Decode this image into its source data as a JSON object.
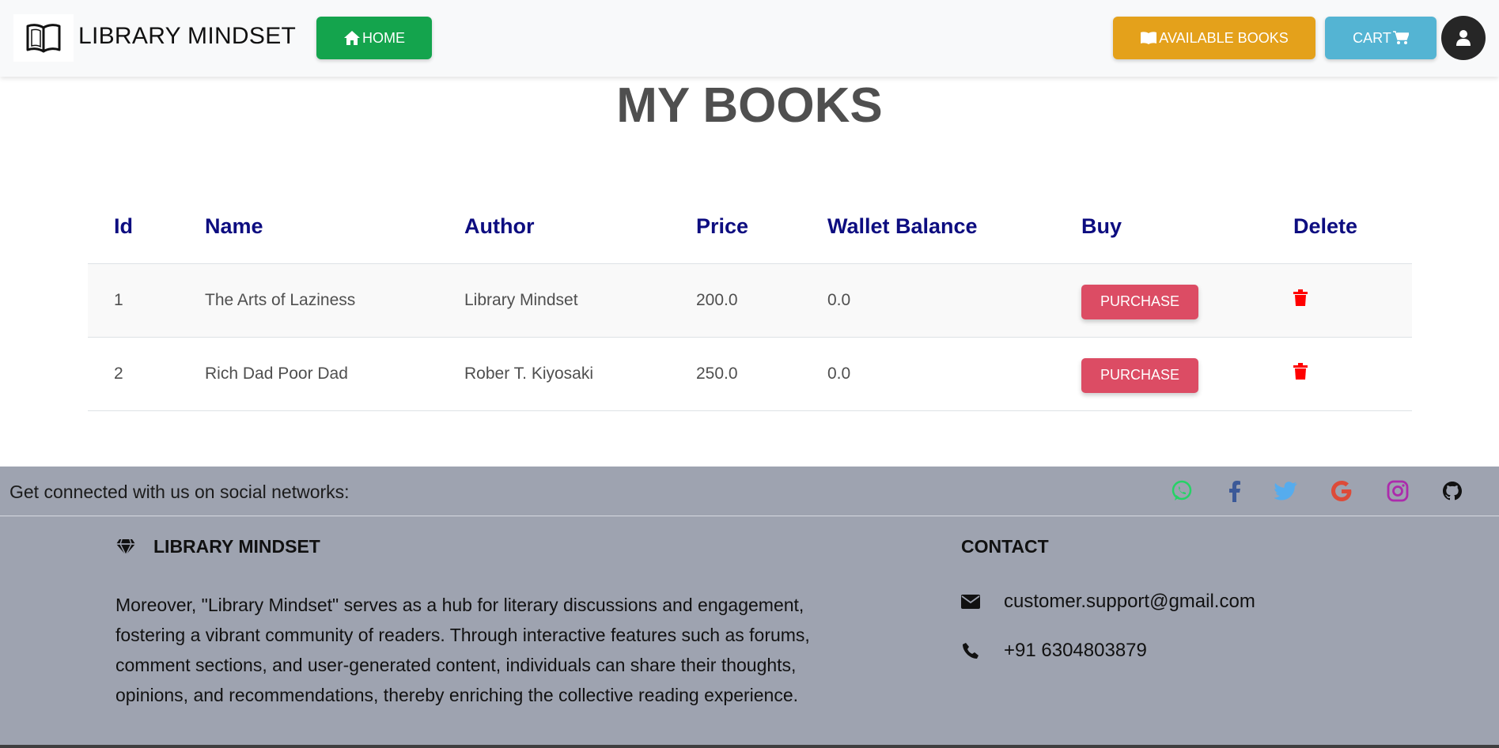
{
  "navbar": {
    "brand": "LIBRARY MINDSET",
    "home_label": "HOME",
    "available_books_label": "AVAILABLE BOOKS",
    "cart_label": "CART"
  },
  "page_title": "MY BOOKS",
  "table": {
    "headers": [
      "Id",
      "Name",
      "Author",
      "Price",
      "Wallet Balance",
      "Buy",
      "Delete"
    ],
    "rows": [
      {
        "id": "1",
        "name": "The Arts of Laziness",
        "author": "Library Mindset",
        "price": "200.0",
        "wallet": "0.0",
        "buy_label": "PURCHASE"
      },
      {
        "id": "2",
        "name": "Rich Dad Poor Dad",
        "author": "Rober T. Kiyosaki",
        "price": "250.0",
        "wallet": "0.0",
        "buy_label": "PURCHASE"
      }
    ]
  },
  "footer": {
    "social_text": "Get connected with us on social networks:",
    "social_icons": [
      "whatsapp-icon",
      "facebook-icon",
      "twitter-icon",
      "google-icon",
      "instagram-icon",
      "github-icon"
    ],
    "brand": "LIBRARY MINDSET",
    "description": "Moreover, \"Library Mindset\" serves as a hub for literary discussions and engagement, fostering a vibrant community of readers. Through interactive features such as forums, comment sections, and user-generated content, individuals can share their thoughts, opinions, and recommendations, thereby enriching the collective reading experience.",
    "contact_title": "CONTACT",
    "email": "customer.support@gmail.com",
    "phone": "+91 6304803879"
  },
  "colors": {
    "home": "#14a44d",
    "available_books": "#e4a11b",
    "cart": "#54b4d3",
    "purchase": "#dc4c64",
    "table_header": "#0d0d80",
    "footer_bg": "#9ea3b0",
    "delete_icon": "#ff0000"
  }
}
